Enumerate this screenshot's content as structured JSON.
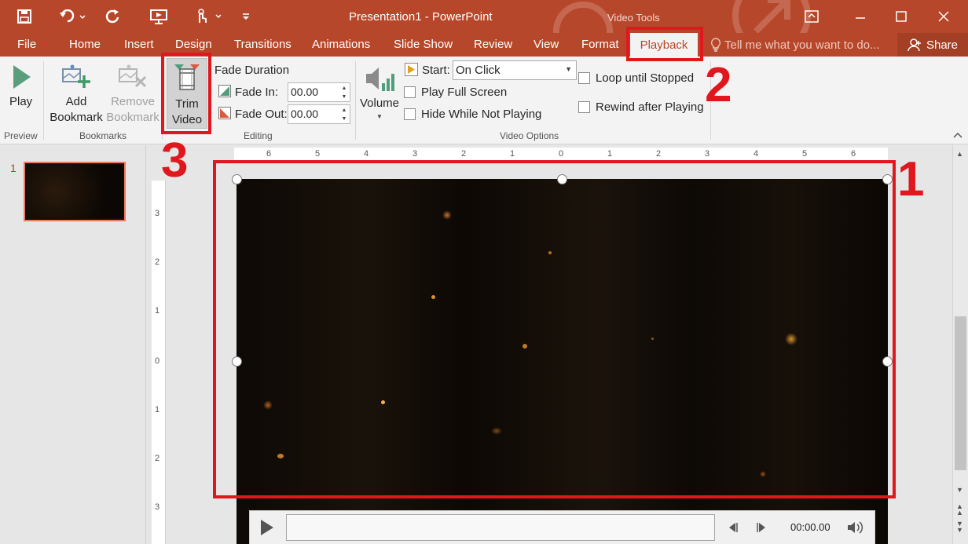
{
  "title_bar": {
    "document_title": "Presentation1 - PowerPoint",
    "context_label": "Video Tools",
    "quick_access_icons": [
      "save-icon",
      "undo-icon",
      "redo-icon",
      "start-from-beginning-icon",
      "touch-mode-icon",
      "customize-icon"
    ],
    "window_controls": [
      "ribbon-display-icon",
      "minimize-icon",
      "maximize-icon",
      "close-icon"
    ]
  },
  "tabs": {
    "file": "File",
    "home": "Home",
    "insert": "Insert",
    "design": "Design",
    "transitions": "Transitions",
    "animations": "Animations",
    "slide_show": "Slide Show",
    "review": "Review",
    "view": "View",
    "format": "Format",
    "playback": "Playback",
    "tell_me": "Tell me what you want to do...",
    "share": "Share"
  },
  "ribbon": {
    "preview": {
      "play": "Play",
      "group": "Preview"
    },
    "bookmarks": {
      "add_1": "Add",
      "add_2": "Bookmark",
      "remove_1": "Remove",
      "remove_2": "Bookmark",
      "group": "Bookmarks"
    },
    "editing": {
      "trim_1": "Trim",
      "trim_2": "Video",
      "fade_duration": "Fade Duration",
      "fade_in_label": "Fade In:",
      "fade_in_value": "00.00",
      "fade_out_label": "Fade Out:",
      "fade_out_value": "00.00",
      "group": "Editing"
    },
    "video_options": {
      "volume": "Volume",
      "start_label": "Start:",
      "start_value": "On Click",
      "play_full_screen": "Play Full Screen",
      "hide_while_not_playing": "Hide While Not Playing",
      "loop_until_stopped": "Loop until Stopped",
      "rewind_after_playing": "Rewind after Playing",
      "group": "Video Options"
    }
  },
  "slides_pane": {
    "slide_number": "1"
  },
  "ruler": {
    "horizontal": [
      "6",
      "5",
      "4",
      "3",
      "2",
      "1",
      "0",
      "1",
      "2",
      "3",
      "4",
      "5",
      "6"
    ],
    "vertical": [
      "3",
      "2",
      "1",
      "0",
      "1",
      "2",
      "3"
    ]
  },
  "player": {
    "time": "00:00.00"
  },
  "annotations": {
    "one": "1",
    "two": "2",
    "three": "3"
  },
  "colors": {
    "accent": "#b7472a",
    "annotation_red": "#e0181e",
    "ribbon_bg": "#f3f3f3"
  }
}
